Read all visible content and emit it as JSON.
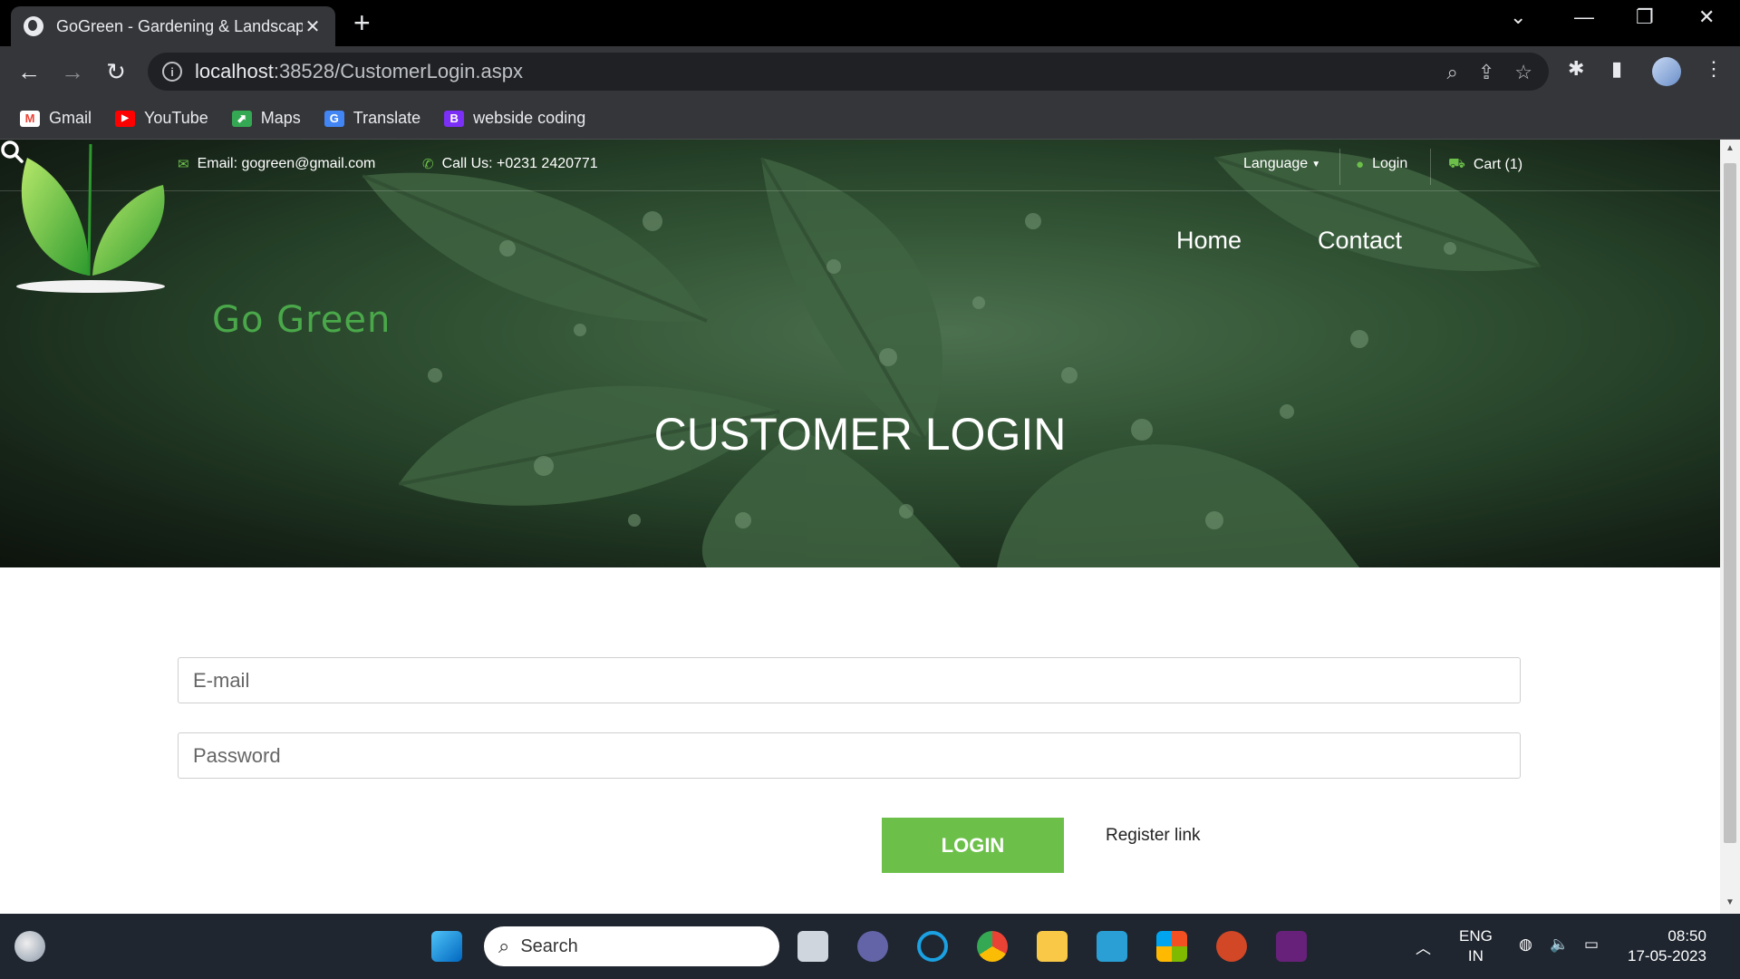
{
  "browser": {
    "tab_title": "GoGreen - Gardening & Landscaping",
    "tab_close": "✕",
    "new_tab": "+",
    "url_host": "localhost",
    "url_rest": ":38528/CustomerLogin.aspx",
    "bookmarks": [
      {
        "label": "Gmail",
        "icon": "gmail-icon",
        "color": "#ea4335",
        "glyph": "M"
      },
      {
        "label": "YouTube",
        "icon": "youtube-icon",
        "color": "#ff0000",
        "glyph": "▶"
      },
      {
        "label": "Maps",
        "icon": "maps-icon",
        "color": "#34a853",
        "glyph": "⬈"
      },
      {
        "label": "Translate",
        "icon": "translate-icon",
        "color": "#4285f4",
        "glyph": "G"
      },
      {
        "label": "webside coding",
        "icon": "bootstrap-icon",
        "color": "#7b2ff7",
        "glyph": "B"
      }
    ]
  },
  "site": {
    "topbar": {
      "email": "Email: gogreen@gmail.com",
      "phone": "Call Us: +0231 2420771",
      "language": "Language",
      "login": "Login",
      "cart": "Cart (1)"
    },
    "logo_text": "Go Green",
    "nav": {
      "home": "Home",
      "contact": "Contact"
    },
    "hero_title": "CUSTOMER LOGIN",
    "form": {
      "email_placeholder": "E-mail",
      "password_placeholder": "Password",
      "login_button": "LOGIN",
      "register_link": "Register link"
    },
    "accent_color": "#6cc04a"
  },
  "taskbar": {
    "search_label": "Search",
    "lang_top": "ENG",
    "lang_bottom": "IN",
    "time": "08:50",
    "date": "17-05-2023"
  }
}
